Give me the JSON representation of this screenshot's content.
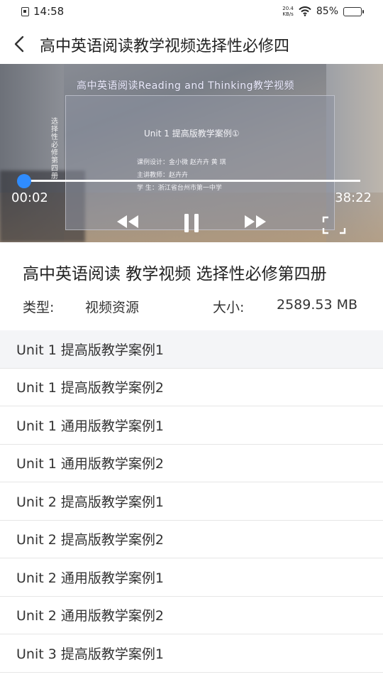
{
  "status_bar": {
    "time": "14:58",
    "net_speed_value": "20.4",
    "net_speed_unit": "KB/s",
    "battery": "85%"
  },
  "header": {
    "title": "高中英语阅读教学视频选择性必修四"
  },
  "video": {
    "slide": {
      "title": "高中英语阅读Reading and Thinking教学视频",
      "side_text": "选择性必修 第四册",
      "unit": "Unit 1 提高版教学案例①",
      "line1": "课例设计：金小微 赵卉卉 黄 琪",
      "line2": "主讲教师：赵卉卉",
      "line3": "学 生：浙江省台州市第一中学"
    },
    "current_time": "00:02",
    "total_time": "38:22",
    "progress": 0.001
  },
  "info": {
    "title": "高中英语阅读 教学视频 选择性必修第四册",
    "type_label": "类型:",
    "type_value": "视频资源",
    "size_label": "大小:",
    "size_value": "2589.53 MB"
  },
  "list": [
    {
      "label": "Unit 1 提高版教学案例1",
      "active": true
    },
    {
      "label": "Unit 1 提高版教学案例2",
      "active": false
    },
    {
      "label": "Unit 1 通用版教学案例1",
      "active": false
    },
    {
      "label": "Unit 1 通用版教学案例2",
      "active": false
    },
    {
      "label": "Unit 2 提高版教学案例1",
      "active": false
    },
    {
      "label": "Unit 2 提高版教学案例2",
      "active": false
    },
    {
      "label": "Unit 2 通用版教学案例1",
      "active": false
    },
    {
      "label": "Unit 2 通用版教学案例2",
      "active": false
    },
    {
      "label": "Unit 3 提高版教学案例1",
      "active": false
    }
  ],
  "colors": {
    "accent": "#2f8cff",
    "active_row": "#f4f5f7"
  },
  "icons": {
    "back": "chevron-left-icon",
    "rewind": "rewind-icon",
    "pause": "pause-icon",
    "forward": "fast-forward-icon",
    "fullscreen": "fullscreen-icon",
    "wifi": "wifi-icon",
    "battery": "battery-icon",
    "sim": "sim-icon"
  }
}
